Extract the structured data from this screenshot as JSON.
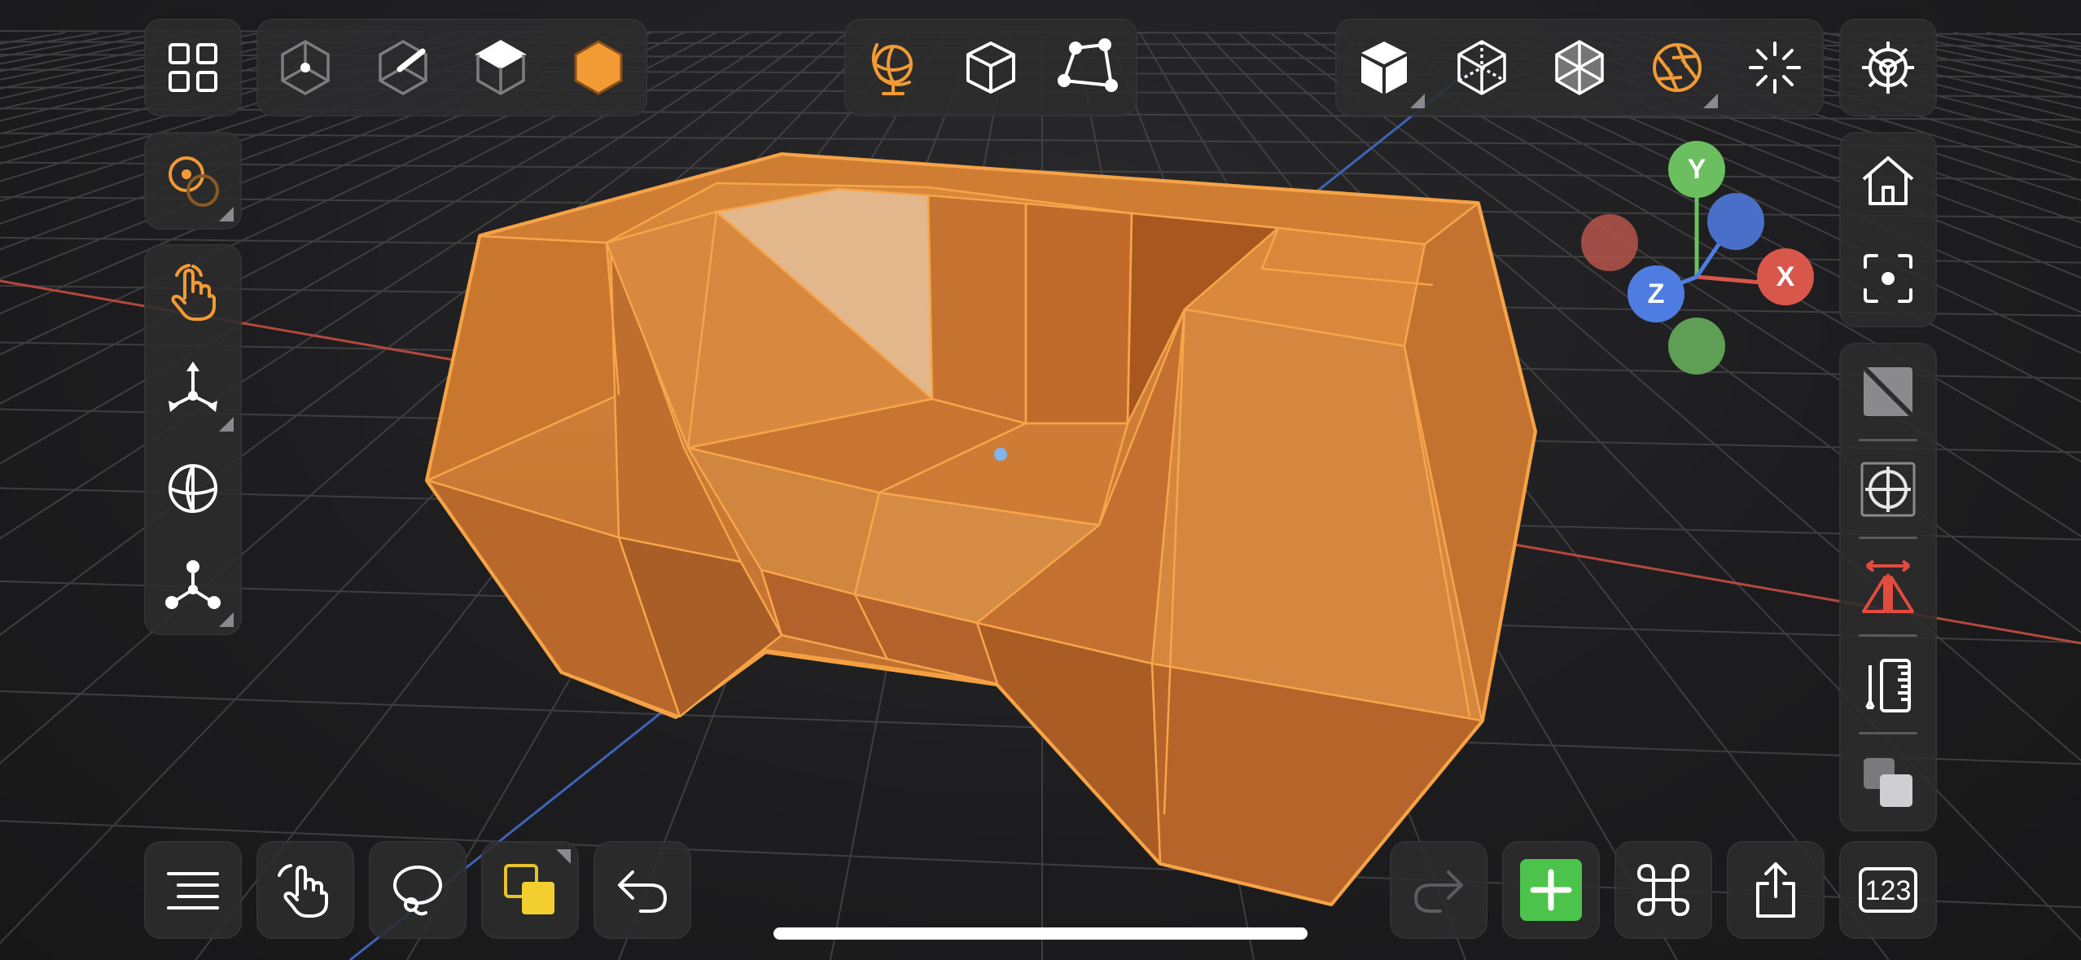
{
  "app": {
    "accent_color": "#F29A33",
    "selection_color": "#F0A040",
    "panel_color": "#2C2C2E"
  },
  "top_toolbar": {
    "left": [
      {
        "icon": "grid-icon",
        "name": "objects-grid-button"
      },
      {
        "icon": "vertex-select-icon",
        "name": "vertex-mode-button"
      },
      {
        "icon": "edge-select-icon",
        "name": "edge-mode-button"
      },
      {
        "icon": "face-select-icon",
        "name": "face-mode-button"
      },
      {
        "icon": "object-select-icon",
        "name": "object-mode-button",
        "active": true
      }
    ],
    "center": [
      {
        "icon": "globe-icon",
        "name": "global-space-button",
        "active": true
      },
      {
        "icon": "cube-outline-icon",
        "name": "local-space-button"
      },
      {
        "icon": "polygon-icon",
        "name": "normal-space-button"
      }
    ],
    "right": [
      {
        "icon": "solid-cube-icon",
        "name": "solid-shading-button"
      },
      {
        "icon": "wireframe-cube-icon",
        "name": "wireframe-shading-button"
      },
      {
        "icon": "xray-cube-icon",
        "name": "xray-shading-button"
      },
      {
        "icon": "aperture-icon",
        "name": "camera-lens-button",
        "active": true
      },
      {
        "icon": "sparkle-icon",
        "name": "lighting-button"
      }
    ],
    "settings": {
      "icon": "gear-icon",
      "name": "settings-button"
    }
  },
  "left_toolbar": [
    {
      "icon": "pivot-icon",
      "name": "pivot-button"
    },
    {
      "icon": "hand-tap-icon",
      "name": "select-tool-button",
      "active": true
    },
    {
      "icon": "move-arrows-icon",
      "name": "transform-tool-button"
    },
    {
      "icon": "sphere-icon",
      "name": "rotate-tool-button"
    },
    {
      "icon": "tri-nodes-icon",
      "name": "scale-tool-button"
    }
  ],
  "right_toolbar": [
    {
      "icon": "home-icon",
      "name": "home-view-button"
    },
    {
      "icon": "focus-icon",
      "name": "focus-button"
    },
    {
      "icon": "slash-square-icon",
      "name": "subdivision-toggle-button"
    },
    {
      "icon": "crosshair-icon",
      "name": "snap-button"
    },
    {
      "icon": "mirror-icon",
      "name": "mirror-button",
      "active": true
    },
    {
      "icon": "ruler-icon",
      "name": "measure-button"
    },
    {
      "icon": "layers-icon",
      "name": "layers-button"
    }
  ],
  "gizmo": {
    "x_label": "X",
    "y_label": "Y",
    "z_label": "Z",
    "x_color": "#D9574A",
    "y_color": "#6CBF5E",
    "z_color": "#4F7CE0"
  },
  "bottom_toolbar": {
    "left": [
      {
        "icon": "list-icon",
        "name": "outliner-button"
      },
      {
        "icon": "hand-drag-icon",
        "name": "manipulate-button"
      },
      {
        "icon": "lasso-icon",
        "name": "lasso-button"
      },
      {
        "icon": "duplicate-squares-icon",
        "name": "selection-mode-button"
      },
      {
        "icon": "undo-icon",
        "name": "undo-button"
      }
    ],
    "right": [
      {
        "icon": "redo-icon",
        "name": "redo-button",
        "disabled": true
      },
      {
        "icon": "plus-icon",
        "name": "add-object-button"
      },
      {
        "icon": "command-icon",
        "name": "commands-button"
      },
      {
        "icon": "share-icon",
        "name": "share-button"
      },
      {
        "icon": "numeric-icon",
        "name": "numeric-input-button"
      }
    ],
    "numeric_label": "123"
  }
}
